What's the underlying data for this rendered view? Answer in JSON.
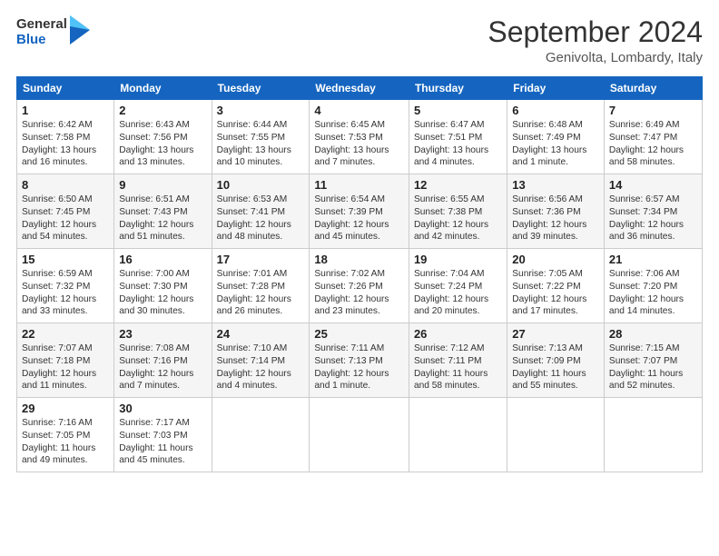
{
  "header": {
    "logo_line1": "General",
    "logo_line2": "Blue",
    "month": "September 2024",
    "location": "Genivolta, Lombardy, Italy"
  },
  "weekdays": [
    "Sunday",
    "Monday",
    "Tuesday",
    "Wednesday",
    "Thursday",
    "Friday",
    "Saturday"
  ],
  "weeks": [
    [
      {
        "day": "1",
        "info": "Sunrise: 6:42 AM\nSunset: 7:58 PM\nDaylight: 13 hours\nand 16 minutes."
      },
      {
        "day": "2",
        "info": "Sunrise: 6:43 AM\nSunset: 7:56 PM\nDaylight: 13 hours\nand 13 minutes."
      },
      {
        "day": "3",
        "info": "Sunrise: 6:44 AM\nSunset: 7:55 PM\nDaylight: 13 hours\nand 10 minutes."
      },
      {
        "day": "4",
        "info": "Sunrise: 6:45 AM\nSunset: 7:53 PM\nDaylight: 13 hours\nand 7 minutes."
      },
      {
        "day": "5",
        "info": "Sunrise: 6:47 AM\nSunset: 7:51 PM\nDaylight: 13 hours\nand 4 minutes."
      },
      {
        "day": "6",
        "info": "Sunrise: 6:48 AM\nSunset: 7:49 PM\nDaylight: 13 hours\nand 1 minute."
      },
      {
        "day": "7",
        "info": "Sunrise: 6:49 AM\nSunset: 7:47 PM\nDaylight: 12 hours\nand 58 minutes."
      }
    ],
    [
      {
        "day": "8",
        "info": "Sunrise: 6:50 AM\nSunset: 7:45 PM\nDaylight: 12 hours\nand 54 minutes."
      },
      {
        "day": "9",
        "info": "Sunrise: 6:51 AM\nSunset: 7:43 PM\nDaylight: 12 hours\nand 51 minutes."
      },
      {
        "day": "10",
        "info": "Sunrise: 6:53 AM\nSunset: 7:41 PM\nDaylight: 12 hours\nand 48 minutes."
      },
      {
        "day": "11",
        "info": "Sunrise: 6:54 AM\nSunset: 7:39 PM\nDaylight: 12 hours\nand 45 minutes."
      },
      {
        "day": "12",
        "info": "Sunrise: 6:55 AM\nSunset: 7:38 PM\nDaylight: 12 hours\nand 42 minutes."
      },
      {
        "day": "13",
        "info": "Sunrise: 6:56 AM\nSunset: 7:36 PM\nDaylight: 12 hours\nand 39 minutes."
      },
      {
        "day": "14",
        "info": "Sunrise: 6:57 AM\nSunset: 7:34 PM\nDaylight: 12 hours\nand 36 minutes."
      }
    ],
    [
      {
        "day": "15",
        "info": "Sunrise: 6:59 AM\nSunset: 7:32 PM\nDaylight: 12 hours\nand 33 minutes."
      },
      {
        "day": "16",
        "info": "Sunrise: 7:00 AM\nSunset: 7:30 PM\nDaylight: 12 hours\nand 30 minutes."
      },
      {
        "day": "17",
        "info": "Sunrise: 7:01 AM\nSunset: 7:28 PM\nDaylight: 12 hours\nand 26 minutes."
      },
      {
        "day": "18",
        "info": "Sunrise: 7:02 AM\nSunset: 7:26 PM\nDaylight: 12 hours\nand 23 minutes."
      },
      {
        "day": "19",
        "info": "Sunrise: 7:04 AM\nSunset: 7:24 PM\nDaylight: 12 hours\nand 20 minutes."
      },
      {
        "day": "20",
        "info": "Sunrise: 7:05 AM\nSunset: 7:22 PM\nDaylight: 12 hours\nand 17 minutes."
      },
      {
        "day": "21",
        "info": "Sunrise: 7:06 AM\nSunset: 7:20 PM\nDaylight: 12 hours\nand 14 minutes."
      }
    ],
    [
      {
        "day": "22",
        "info": "Sunrise: 7:07 AM\nSunset: 7:18 PM\nDaylight: 12 hours\nand 11 minutes."
      },
      {
        "day": "23",
        "info": "Sunrise: 7:08 AM\nSunset: 7:16 PM\nDaylight: 12 hours\nand 7 minutes."
      },
      {
        "day": "24",
        "info": "Sunrise: 7:10 AM\nSunset: 7:14 PM\nDaylight: 12 hours\nand 4 minutes."
      },
      {
        "day": "25",
        "info": "Sunrise: 7:11 AM\nSunset: 7:13 PM\nDaylight: 12 hours\nand 1 minute."
      },
      {
        "day": "26",
        "info": "Sunrise: 7:12 AM\nSunset: 7:11 PM\nDaylight: 11 hours\nand 58 minutes."
      },
      {
        "day": "27",
        "info": "Sunrise: 7:13 AM\nSunset: 7:09 PM\nDaylight: 11 hours\nand 55 minutes."
      },
      {
        "day": "28",
        "info": "Sunrise: 7:15 AM\nSunset: 7:07 PM\nDaylight: 11 hours\nand 52 minutes."
      }
    ],
    [
      {
        "day": "29",
        "info": "Sunrise: 7:16 AM\nSunset: 7:05 PM\nDaylight: 11 hours\nand 49 minutes."
      },
      {
        "day": "30",
        "info": "Sunrise: 7:17 AM\nSunset: 7:03 PM\nDaylight: 11 hours\nand 45 minutes."
      },
      {
        "day": "",
        "info": ""
      },
      {
        "day": "",
        "info": ""
      },
      {
        "day": "",
        "info": ""
      },
      {
        "day": "",
        "info": ""
      },
      {
        "day": "",
        "info": ""
      }
    ]
  ]
}
